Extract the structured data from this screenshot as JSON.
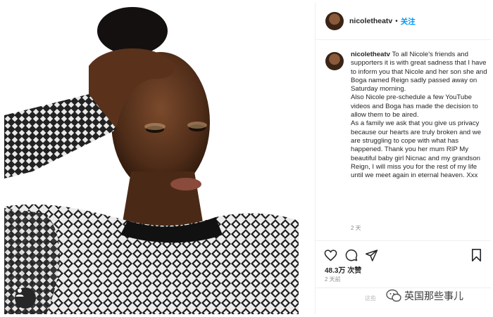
{
  "post": {
    "username": "nicoletheatv",
    "separator": "•",
    "follow_label": "关注",
    "caption_lines": [
      "To all Nicole's friends and supporters it is with great sadness that I have to inform you that Nicole and her son she and Boga named Reign sadly passed away on Saturday morning.",
      "Also Nicole pre-schedule a few YouTube videos and Boga has made the decision to allow them to be aired.",
      "As a family we ask that you give us privacy because our hearts are truly broken and we are struggling to cope with what has happened. Thank you her mum RIP My beautiful baby girl Nicnac and my grandson Reign, I will miss you for the rest of my life until we meet again in eternal heaven. Xxx"
    ],
    "comment_age": "2 天",
    "likes": "48.3万 次赞",
    "posted_ago": "2 天前"
  },
  "icons": {
    "like": "heart-icon",
    "comment": "comment-icon",
    "share": "paper-plane-icon",
    "save": "bookmark-icon",
    "user": "user-icon",
    "watermark": "wechat-icon"
  },
  "watermark": {
    "text": "英国那些事儿",
    "subtext": "这些"
  },
  "colors": {
    "follow": "#0095f6",
    "muted": "#8e8e8e",
    "text": "#262626"
  }
}
